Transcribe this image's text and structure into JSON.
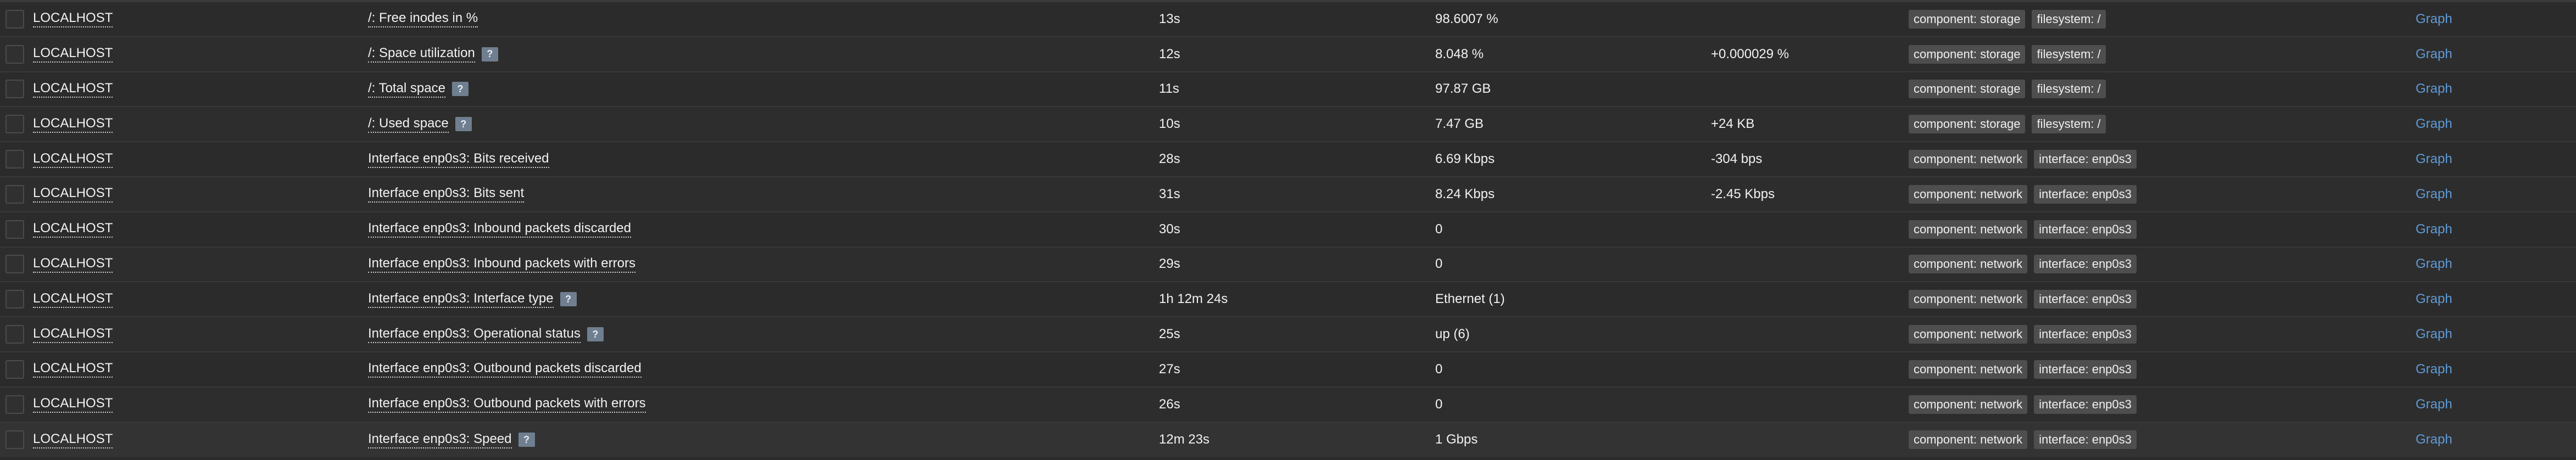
{
  "rows": [
    {
      "host": "LOCALHOST",
      "name": "/: Free inodes in %",
      "hint": false,
      "last_check": "13s",
      "last_value": "98.6007 %",
      "change": "",
      "tags": [
        "component: storage",
        "filesystem: /"
      ],
      "graph": "Graph"
    },
    {
      "host": "LOCALHOST",
      "name": "/: Space utilization",
      "hint": true,
      "last_check": "12s",
      "last_value": "8.048 %",
      "change": "+0.000029 %",
      "tags": [
        "component: storage",
        "filesystem: /"
      ],
      "graph": "Graph"
    },
    {
      "host": "LOCALHOST",
      "name": "/: Total space",
      "hint": true,
      "last_check": "11s",
      "last_value": "97.87 GB",
      "change": "",
      "tags": [
        "component: storage",
        "filesystem: /"
      ],
      "graph": "Graph"
    },
    {
      "host": "LOCALHOST",
      "name": "/: Used space",
      "hint": true,
      "last_check": "10s",
      "last_value": "7.47 GB",
      "change": "+24 KB",
      "tags": [
        "component: storage",
        "filesystem: /"
      ],
      "graph": "Graph"
    },
    {
      "host": "LOCALHOST",
      "name": "Interface enp0s3: Bits received",
      "hint": false,
      "last_check": "28s",
      "last_value": "6.69 Kbps",
      "change": "-304 bps",
      "tags": [
        "component: network",
        "interface: enp0s3"
      ],
      "graph": "Graph"
    },
    {
      "host": "LOCALHOST",
      "name": "Interface enp0s3: Bits sent",
      "hint": false,
      "last_check": "31s",
      "last_value": "8.24 Kbps",
      "change": "-2.45 Kbps",
      "tags": [
        "component: network",
        "interface: enp0s3"
      ],
      "graph": "Graph"
    },
    {
      "host": "LOCALHOST",
      "name": "Interface enp0s3: Inbound packets discarded",
      "hint": false,
      "last_check": "30s",
      "last_value": "0",
      "change": "",
      "tags": [
        "component: network",
        "interface: enp0s3"
      ],
      "graph": "Graph"
    },
    {
      "host": "LOCALHOST",
      "name": "Interface enp0s3: Inbound packets with errors",
      "hint": false,
      "last_check": "29s",
      "last_value": "0",
      "change": "",
      "tags": [
        "component: network",
        "interface: enp0s3"
      ],
      "graph": "Graph"
    },
    {
      "host": "LOCALHOST",
      "name": "Interface enp0s3: Interface type",
      "hint": true,
      "last_check": "1h 12m 24s",
      "last_value": "Ethernet (1)",
      "change": "",
      "tags": [
        "component: network",
        "interface: enp0s3"
      ],
      "graph": "Graph"
    },
    {
      "host": "LOCALHOST",
      "name": "Interface enp0s3: Operational status",
      "hint": true,
      "last_check": "25s",
      "last_value": "up (6)",
      "change": "",
      "tags": [
        "component: network",
        "interface: enp0s3"
      ],
      "graph": "Graph"
    },
    {
      "host": "LOCALHOST",
      "name": "Interface enp0s3: Outbound packets discarded",
      "hint": false,
      "last_check": "27s",
      "last_value": "0",
      "change": "",
      "tags": [
        "component: network",
        "interface: enp0s3"
      ],
      "graph": "Graph"
    },
    {
      "host": "LOCALHOST",
      "name": "Interface enp0s3: Outbound packets with errors",
      "hint": false,
      "last_check": "26s",
      "last_value": "0",
      "change": "",
      "tags": [
        "component: network",
        "interface: enp0s3"
      ],
      "graph": "Graph"
    },
    {
      "host": "LOCALHOST",
      "name": "Interface enp0s3: Speed",
      "hint": true,
      "last_check": "12m 23s",
      "last_value": "1 Gbps",
      "change": "",
      "tags": [
        "component: network",
        "interface: enp0s3"
      ],
      "graph": "Graph"
    }
  ],
  "hint_glyph": "?",
  "icons": {
    "hint": "help-icon",
    "checkbox": "checkbox"
  },
  "colors": {
    "background": "#2b2b2b",
    "link": "#5e9ad6",
    "tag": "#4e4e4e",
    "hint": "#6f7f90"
  }
}
